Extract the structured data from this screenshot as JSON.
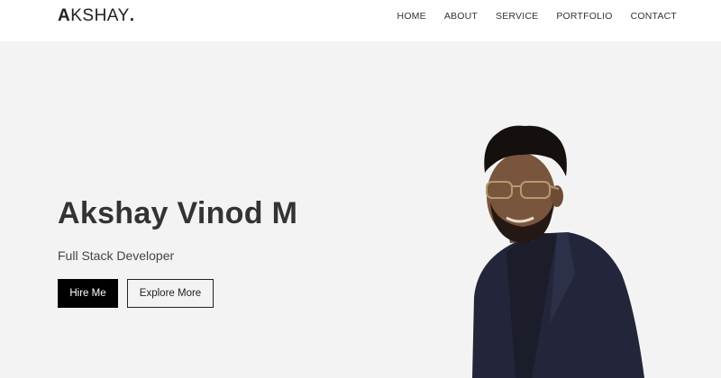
{
  "header": {
    "logo": {
      "first": "A",
      "rest": "KSHAY",
      "dot": "."
    },
    "nav": [
      {
        "label": "HOME"
      },
      {
        "label": "ABOUT"
      },
      {
        "label": "SERVICE"
      },
      {
        "label": "PORTFOLIO"
      },
      {
        "label": "CONTACT"
      }
    ]
  },
  "hero": {
    "name": "Akshay Vinod M",
    "role": "Full Stack Developer",
    "hire_label": "Hire Me",
    "explore_label": "Explore More"
  },
  "colors": {
    "background": "#f3f3f3",
    "header": "#ffffff",
    "primary_button": "#000000",
    "text": "#333333"
  }
}
